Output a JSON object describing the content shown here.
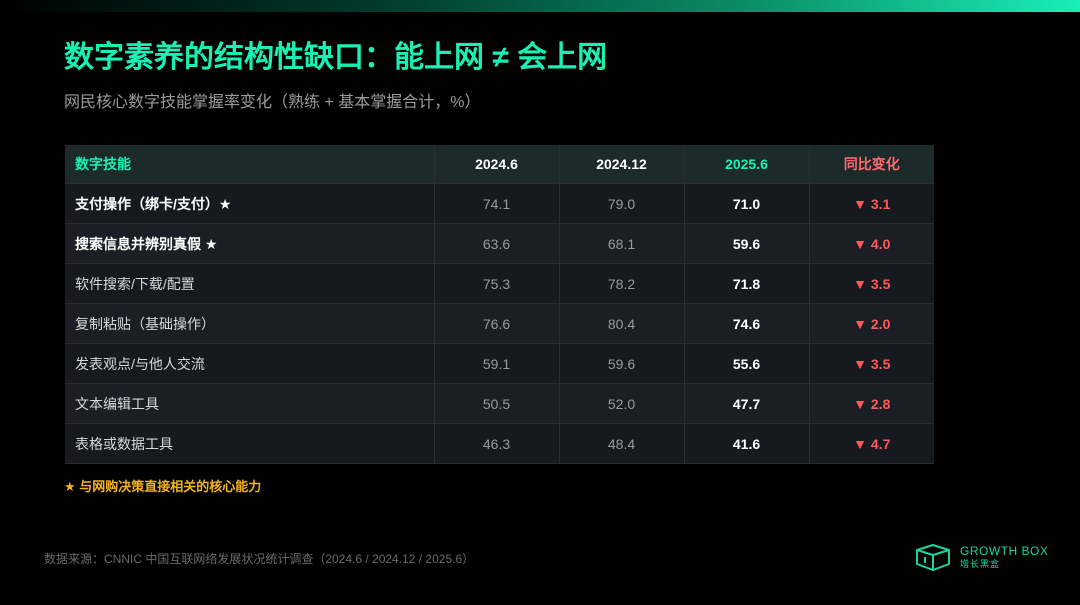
{
  "header": {
    "title": "数字素养的结构性缺口：能上网 ≠ 会上网",
    "subtitle": "网民核心数字技能掌握率变化（熟练 + 基本掌握合计，%）"
  },
  "table": {
    "headers": [
      "数字技能",
      "2024.6",
      "2024.12",
      "2025.6",
      "同比变化"
    ],
    "rows": [
      {
        "skill": "支付操作（绑卡/支付）★",
        "core": true,
        "v2024_6": "74.1",
        "v2024_12": "79.0",
        "v2025_6": "71.0",
        "change": "▼ 3.1"
      },
      {
        "skill": "搜索信息并辨别真假 ★",
        "core": true,
        "v2024_6": "63.6",
        "v2024_12": "68.1",
        "v2025_6": "59.6",
        "change": "▼ 4.0"
      },
      {
        "skill": "软件搜索/下载/配置",
        "core": false,
        "v2024_6": "75.3",
        "v2024_12": "78.2",
        "v2025_6": "71.8",
        "change": "▼ 3.5"
      },
      {
        "skill": "复制粘贴（基础操作）",
        "core": false,
        "v2024_6": "76.6",
        "v2024_12": "80.4",
        "v2025_6": "74.6",
        "change": "▼ 2.0"
      },
      {
        "skill": "发表观点/与他人交流",
        "core": false,
        "v2024_6": "59.1",
        "v2024_12": "59.6",
        "v2025_6": "55.6",
        "change": "▼ 3.5"
      },
      {
        "skill": "文本编辑工具",
        "core": false,
        "v2024_6": "50.5",
        "v2024_12": "52.0",
        "v2025_6": "47.7",
        "change": "▼ 2.8"
      },
      {
        "skill": "表格或数据工具",
        "core": false,
        "v2024_6": "46.3",
        "v2024_12": "48.4",
        "v2025_6": "41.6",
        "change": "▼ 4.7"
      }
    ]
  },
  "footnote": "★ 与网购决策直接相关的核心能力",
  "source": "数据来源：CNNIC 中国互联网络发展状况统计调查（2024.6 / 2024.12 / 2025.6）",
  "logo": {
    "name": "GROWTH BOX",
    "sub": "增长黑盒"
  },
  "colors": {
    "accent": "#19f0b4",
    "decline": "#ff5a5a",
    "footnote": "#f5b21a"
  }
}
